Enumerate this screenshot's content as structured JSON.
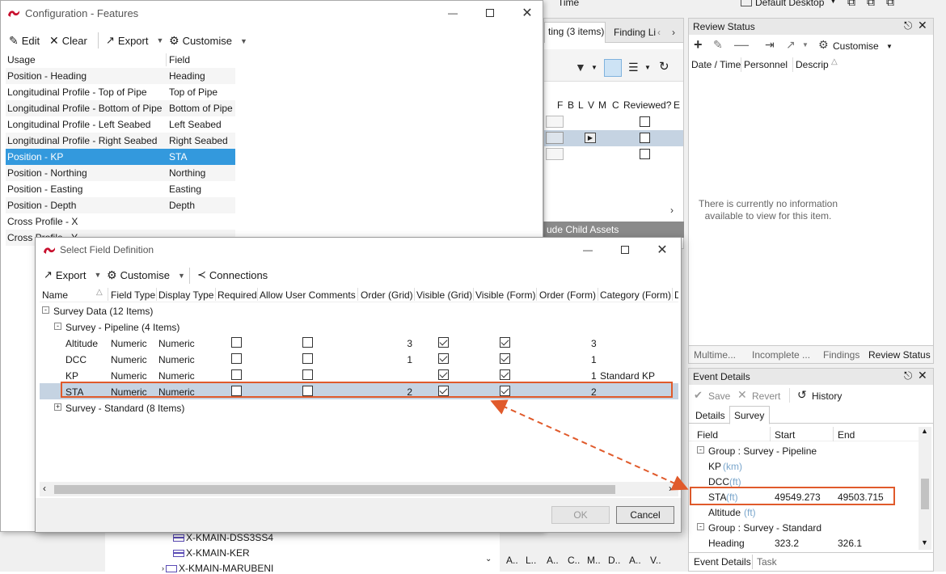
{
  "background": {
    "top_time": "Time",
    "default_desktop": "Default Desktop",
    "mid_tab1": "ting (3 items)",
    "mid_tab2": "Finding Li",
    "mid_cols": [
      "F",
      "B",
      "L",
      "V",
      "M",
      "C",
      "Reviewed?",
      "E"
    ],
    "include_child": "ude Child Assets",
    "tree_items": [
      "X-KMAIN-DSS3SS4",
      "X-KMAIN-KER",
      "X-KMAIN-MARUBENI"
    ],
    "bottom_tabs": [
      "A..",
      "L..",
      "A..",
      "C..",
      "M..",
      "D..",
      "A..",
      "V.."
    ],
    "review_status": {
      "title": "Review Status",
      "customise": "Customise",
      "cols": [
        "Date / Time",
        "Personnel",
        "Descrip"
      ],
      "empty_msg_line1": "There is currently no information",
      "empty_msg_line2": "available to view for this item.",
      "tabs": [
        "Multime...",
        "Incomplete ...",
        "Findings",
        "Review Status"
      ]
    },
    "event_details": {
      "title": "Event Details",
      "save": "Save",
      "revert": "Revert",
      "history": "History",
      "tabs": [
        "Details",
        "Survey"
      ],
      "cols": [
        "Field",
        "Start",
        "End"
      ],
      "group1": "Group : Survey - Pipeline",
      "group2": "Group : Survey - Standard",
      "rows": [
        {
          "name": "KP",
          "unit": "(km)",
          "start": "",
          "end": ""
        },
        {
          "name": "DCC",
          "unit": "(ft)",
          "start": "",
          "end": ""
        },
        {
          "name": "STA",
          "unit": "(ft)",
          "start": "49549.273",
          "end": "49503.715"
        },
        {
          "name": "Altitude",
          "unit": "(ft)",
          "start": "",
          "end": ""
        }
      ],
      "heading_row": {
        "name": "Heading",
        "start": "323.2",
        "end": "326.1"
      },
      "bottom_tabs": [
        "Event Details",
        "Task"
      ]
    }
  },
  "config_window": {
    "title": "Configuration - Features",
    "toolbar": {
      "edit": "Edit",
      "clear": "Clear",
      "export": "Export",
      "customise": "Customise"
    },
    "columns": [
      "Usage",
      "Field"
    ],
    "rows": [
      {
        "usage": "Position - Heading",
        "field": "Heading"
      },
      {
        "usage": "Longitudinal Profile - Top of Pipe",
        "field": "Top of Pipe"
      },
      {
        "usage": "Longitudinal Profile - Bottom of Pipe",
        "field": "Bottom of Pipe"
      },
      {
        "usage": "Longitudinal Profile - Left Seabed",
        "field": "Left Seabed"
      },
      {
        "usage": "Longitudinal Profile - Right Seabed",
        "field": "Right Seabed"
      },
      {
        "usage": "Position - KP",
        "field": "STA"
      },
      {
        "usage": "Position - Northing",
        "field": "Northing"
      },
      {
        "usage": "Position - Easting",
        "field": "Easting"
      },
      {
        "usage": "Position - Depth",
        "field": "Depth"
      },
      {
        "usage": "Cross Profile - X",
        "field": ""
      },
      {
        "usage": "Cross Profile - Y",
        "field": ""
      }
    ]
  },
  "select_dialog": {
    "title": "Select Field Definition",
    "toolbar": {
      "export": "Export",
      "customise": "Customise",
      "connections": "Connections"
    },
    "columns": [
      "Name",
      "Field Type",
      "Display Type",
      "Required",
      "Allow User Comments",
      "Order (Grid)",
      "Visible (Grid)",
      "Visible (Form)",
      "Order (Form)",
      "Category (Form)",
      "D"
    ],
    "group_survey_data": "Survey Data (12 Items)",
    "group_pipeline": "Survey - Pipeline (4 Items)",
    "group_standard": "Survey - Standard (8 Items)",
    "rows": [
      {
        "name": "Altitude",
        "ftype": "Numeric",
        "dtype": "Numeric",
        "order_grid": "3",
        "order_form": "3",
        "category": ""
      },
      {
        "name": "DCC",
        "ftype": "Numeric",
        "dtype": "Numeric",
        "order_grid": "1",
        "order_form": "1",
        "category": ""
      },
      {
        "name": "KP",
        "ftype": "Numeric",
        "dtype": "Numeric",
        "order_grid": "",
        "order_form": "1",
        "category": "Standard KP"
      },
      {
        "name": "STA",
        "ftype": "Numeric",
        "dtype": "Numeric",
        "order_grid": "2",
        "order_form": "2",
        "category": ""
      }
    ],
    "ok": "OK",
    "cancel": "Cancel"
  },
  "colors": {
    "accent_orange": "#e05a2b",
    "selection_blue": "#3399dd",
    "row_selected": "#c5d3e2",
    "logo_red": "#c8102e"
  }
}
